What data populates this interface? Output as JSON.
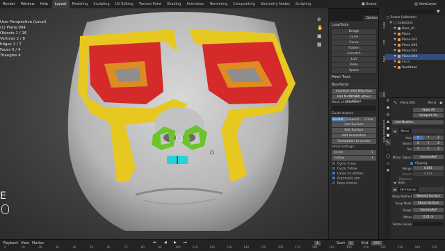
{
  "topbar": {
    "menus": [
      "Render",
      "Window",
      "Help"
    ],
    "workspaces": [
      "Layout",
      "Modeling",
      "Sculpting",
      "UV Editing",
      "Texture Paint",
      "Shading",
      "Animation",
      "Rendering",
      "Compositing",
      "Geometry Nodes",
      "Scripting"
    ],
    "active_workspace": "Layout",
    "scene": "Scene",
    "view_layer": "ViewLayer"
  },
  "viewport": {
    "overlay_lines": [
      "User Perspective (Local)",
      "(1) Plane.004",
      "Objects  1 / 16",
      "Vertices  2 / 8",
      "Edges  1 / 7",
      "Faces  0 / 4",
      "Triangles  4"
    ],
    "options_label": "Options",
    "mode_letter": "E"
  },
  "toolpanel": {
    "looptools_header": "LoopTools",
    "looptools_items": [
      "Bridge",
      "Circle",
      "Curve",
      "Flatten",
      "Gstretch",
      "Loft",
      "Relax",
      "Space"
    ],
    "mesh_tools_header": "Mesh Tools",
    "bsurfaces_header": "Bsurfaces",
    "init_button": "Initialize (Add BSurface mesh)",
    "add_mirror_button": "Add Mirror and others modifiers",
    "mesh_of_label": "Mesh of BSurface:",
    "guide_strokes_label": "Guide strokes",
    "guide_tabs": [
      "Annotat...",
      "Grease P...",
      "Curve"
    ],
    "add_surface": "Add Surface",
    "edit_surface": "Edit Surface",
    "add_annotation": "Add Annotation",
    "annotation_to_curves": "Annotation to curves",
    "initial_settings_label": "Initial settings:",
    "cross_label": "Cross",
    "follow_label": "Follow",
    "field_value": "1",
    "checkboxes": [
      {
        "label": "Cyclic Cross",
        "checked": false
      },
      {
        "label": "Cyclic Follow",
        "checked": false
      },
      {
        "label": "Loops on strokes",
        "checked": true
      },
      {
        "label": "Automatic join",
        "checked": true
      },
      {
        "label": "Keep strokes",
        "checked": false
      }
    ]
  },
  "side_tabs": [
    "Item",
    "Tool",
    "View",
    "Edit",
    "Screencast Keys"
  ],
  "outliner": {
    "search_placeholder": "",
    "rows": [
      {
        "label": "Scene Collection",
        "indent": 0,
        "selected": false,
        "icon_color": "#d9d9d9"
      },
      {
        "label": "Collection",
        "indent": 1,
        "selected": false,
        "icon_color": "#d9d9d9"
      },
      {
        "label": "Base_01",
        "indent": 2,
        "selected": false,
        "icon_color": "#e8a050"
      },
      {
        "label": "Plane",
        "indent": 2,
        "selected": false,
        "icon_color": "#e8a050"
      },
      {
        "label": "Plane.001",
        "indent": 2,
        "selected": false,
        "icon_color": "#e8a050"
      },
      {
        "label": "Plane.002",
        "indent": 2,
        "selected": false,
        "icon_color": "#e8a050"
      },
      {
        "label": "Plane.003",
        "indent": 2,
        "selected": false,
        "icon_color": "#e8a050"
      },
      {
        "label": "Plane.004",
        "indent": 2,
        "selected": true,
        "icon_color": "#e8a050"
      },
      {
        "label": "Mask",
        "indent": 2,
        "selected": false,
        "icon_color": "#e8a050"
      },
      {
        "label": "RootNode",
        "indent": 2,
        "selected": false,
        "icon_color": "#e8a050"
      }
    ]
  },
  "properties": {
    "object_name": "Plane.004",
    "modifier_menu": "Mirror",
    "apply_all": "Apply All",
    "viewport_vis": "Viewport Vis",
    "add_modifier": "Add Modifier",
    "mirror_name": "Mirror",
    "axis_label": "Axis",
    "bisect_label": "Bisect",
    "flip_label": "Flip",
    "axis_x": "X",
    "axis_y": "Y",
    "axis_z": "Z",
    "mirror_object_label": "Mirror Object",
    "mirror_object_value": "GenesisRef",
    "clipping_label": "Clipping",
    "merge_label": "Merge",
    "merge_value": "0.001",
    "bisect_distance_label": "Bisect Distance",
    "bisect_distance_value": "0.001",
    "data_label": "Data",
    "shrinkwrap_name": "Shrinkwrap",
    "wrap_method_label": "Wrap Method",
    "wrap_method_value": "Nearest Surface",
    "snap_mode_label": "Snap Mode",
    "snap_mode_value": "Above Surface",
    "target_label": "Target",
    "target_value": "GenesisRef",
    "offset_label": "Offset",
    "offset_value": "0.01 m",
    "vertex_group_label": "Vertex Group"
  },
  "timeline": {
    "menus": [
      "Playback",
      "View",
      "Marker"
    ],
    "ticks": [
      "0",
      "10",
      "20",
      "30",
      "40",
      "50",
      "60",
      "70",
      "80",
      "90",
      "100",
      "110",
      "120",
      "130",
      "140",
      "150",
      "160",
      "170",
      "180",
      "190",
      "200",
      "210",
      "220",
      "230",
      "240",
      "250"
    ],
    "start_label": "Start",
    "start_value": "1",
    "end_label": "End",
    "end_value": "250",
    "current_frame": "1"
  },
  "colors": {
    "mask_red": "#d42a2a",
    "mask_yellow": "#e6c820",
    "mask_orange": "#e08a22",
    "mask_green": "#6cc42a",
    "mask_cyan": "#2ad0d8",
    "selection_blue": "#4772b3"
  }
}
